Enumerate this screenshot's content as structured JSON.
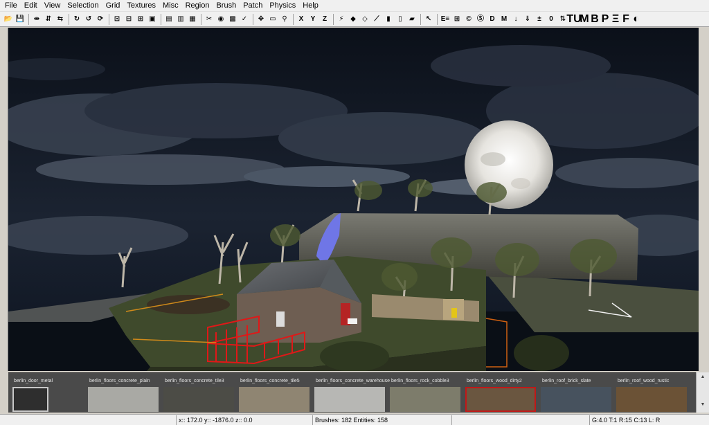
{
  "menu": [
    "File",
    "Edit",
    "View",
    "Selection",
    "Grid",
    "Textures",
    "Misc",
    "Region",
    "Brush",
    "Patch",
    "Physics",
    "Help"
  ],
  "toolbar": {
    "icons": [
      {
        "name": "open-icon",
        "glyph": "📂"
      },
      {
        "name": "save-icon",
        "glyph": "💾"
      },
      {
        "sep": true
      },
      {
        "name": "flip-x-icon",
        "glyph": "⇹"
      },
      {
        "name": "flip-y-icon",
        "glyph": "⇵"
      },
      {
        "name": "flip-z-icon",
        "glyph": "⇆"
      },
      {
        "sep": true
      },
      {
        "name": "rotate-x-icon",
        "glyph": "↻"
      },
      {
        "name": "rotate-y-icon",
        "glyph": "↺"
      },
      {
        "name": "rotate-z-icon",
        "glyph": "⟳"
      },
      {
        "sep": true
      },
      {
        "name": "select-touching-icon",
        "glyph": "⊡"
      },
      {
        "name": "select-inside-icon",
        "glyph": "⊟"
      },
      {
        "name": "select-partial-icon",
        "glyph": "⊞"
      },
      {
        "name": "select-complete-icon",
        "glyph": "▣"
      },
      {
        "sep": true
      },
      {
        "name": "csg-subtract-icon",
        "glyph": "▤"
      },
      {
        "name": "csg-merge-icon",
        "glyph": "▥"
      },
      {
        "name": "csg-hollow-icon",
        "glyph": "▦"
      },
      {
        "sep": true
      },
      {
        "name": "clipper-icon",
        "glyph": "✂"
      },
      {
        "name": "camera-icon",
        "glyph": "◉"
      },
      {
        "name": "texture-lock-icon",
        "glyph": "▩"
      },
      {
        "name": "scale-lock-icon",
        "glyph": "✓"
      },
      {
        "sep": true
      },
      {
        "name": "change-view-icon",
        "glyph": "✥"
      },
      {
        "name": "texture-view-icon",
        "glyph": "▭"
      },
      {
        "name": "filter-icon",
        "glyph": "⚲"
      },
      {
        "sep": true
      },
      {
        "name": "view-x-icon",
        "glyph": "X"
      },
      {
        "name": "view-y-icon",
        "glyph": "Y"
      },
      {
        "name": "view-z-icon",
        "glyph": "Z"
      },
      {
        "sep": true
      },
      {
        "name": "cubic-clip-icon",
        "glyph": "⚡"
      },
      {
        "name": "patch-icon",
        "glyph": "◆"
      },
      {
        "name": "patch-bend-icon",
        "glyph": "◇"
      },
      {
        "name": "patch-insert-icon",
        "glyph": "⟋"
      },
      {
        "name": "patch-texture-icon",
        "glyph": "▮"
      },
      {
        "name": "patch-fit-icon",
        "glyph": "▯"
      },
      {
        "name": "patch-tess-icon",
        "glyph": "▰"
      },
      {
        "sep": true
      },
      {
        "name": "mouse-pointer-icon",
        "glyph": "↖"
      },
      {
        "sep": true
      },
      {
        "name": "entity-list-icon",
        "glyph": "E≡"
      },
      {
        "name": "brush-entity-icon",
        "glyph": "⊞"
      },
      {
        "name": "radiant-c-icon",
        "glyph": "©"
      },
      {
        "name": "radiant-s-icon",
        "glyph": "Ⓢ"
      },
      {
        "name": "radiant-d-icon",
        "glyph": "D"
      },
      {
        "name": "radiant-m-icon",
        "glyph": "M"
      },
      {
        "name": "down-arrow-icon",
        "glyph": "↓"
      },
      {
        "name": "down-plus-icon",
        "glyph": "⇓"
      },
      {
        "name": "plus-minus-icon",
        "glyph": "±"
      },
      {
        "name": "zero-icon",
        "glyph": "0"
      },
      {
        "name": "shuffle-icon",
        "glyph": "⇅"
      }
    ],
    "letters": [
      "TU",
      "M",
      "B",
      "P",
      "Ξ",
      "F",
      "◐"
    ]
  },
  "textures": [
    {
      "label": "berlin_door_metal",
      "color": "#2e2e2e"
    },
    {
      "label": "berlin_floors_concrete_plain",
      "color": "#a9a9a4"
    },
    {
      "label": "berlin_floors_concrete_tile3",
      "color": "#4c4c46"
    },
    {
      "label": "berlin_floors_concrete_tile5",
      "color": "#8f8572"
    },
    {
      "label": "berlin_floors_concrete_warehouse",
      "color": "#b7b7b4"
    },
    {
      "label": "berlin_floors_rock_cobble3",
      "color": "#7d7c6b"
    },
    {
      "label": "berlin_floors_wood_dirty2",
      "color": "#6a5640"
    },
    {
      "label": "berlin_roof_brick_slate",
      "color": "#47525e"
    },
    {
      "label": "berlin_roof_wood_rustic",
      "color": "#6b5236"
    }
  ],
  "status": {
    "coords": "x:: 172.0  y:: -1876.0  z:: 0.0",
    "counts": "Brushes: 182 Entities: 158",
    "grid": "G:4.0 T:1 R:15 C:13 L: R"
  }
}
